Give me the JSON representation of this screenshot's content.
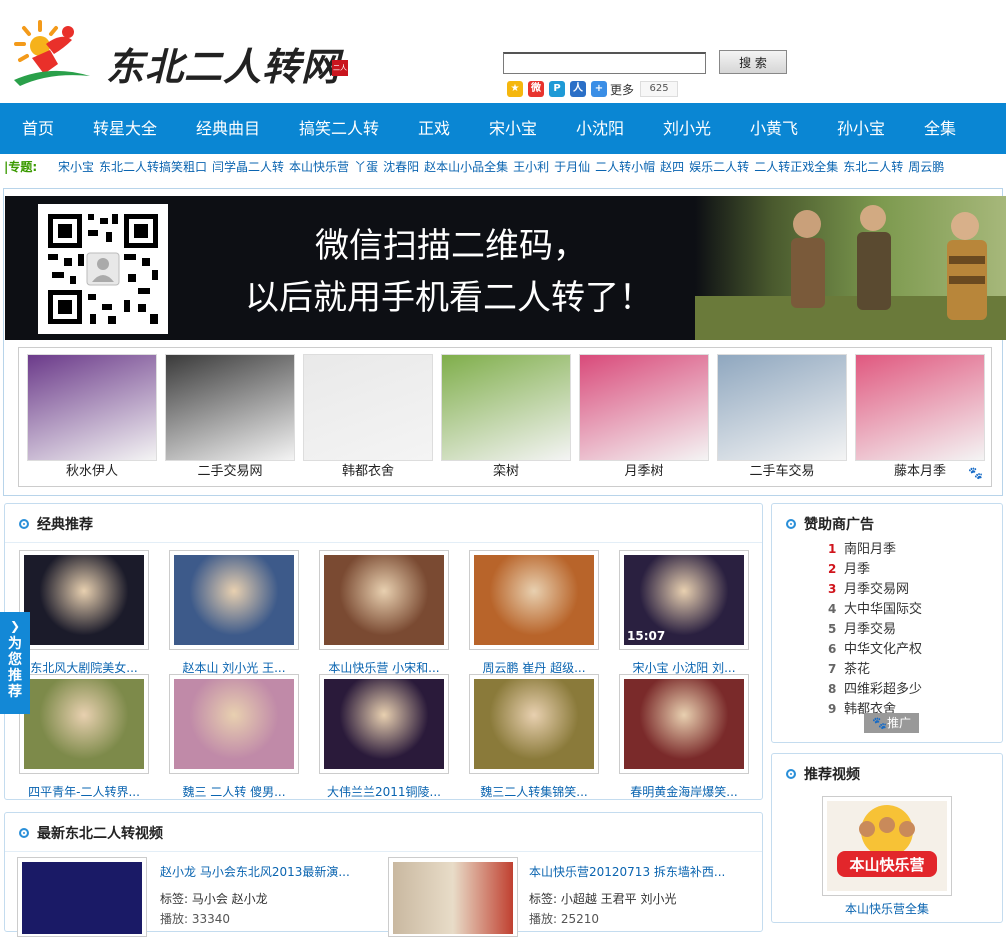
{
  "header": {
    "logo_text": "东北二人转网",
    "logo_stamp": "二人转",
    "search_button": "搜 索",
    "search_value": "",
    "share_more": "更多",
    "share_count": "625"
  },
  "nav": {
    "items": [
      {
        "label": "首页"
      },
      {
        "label": "转星大全"
      },
      {
        "label": "经典曲目"
      },
      {
        "label": "搞笑二人转"
      },
      {
        "label": "正戏"
      },
      {
        "label": "宋小宝"
      },
      {
        "label": "小沈阳"
      },
      {
        "label": "刘小光"
      },
      {
        "label": "小黄飞"
      },
      {
        "label": "孙小宝"
      },
      {
        "label": "全集"
      }
    ]
  },
  "topics": {
    "label": "|专题:",
    "links": [
      "宋小宝",
      "东北二人转搞笑粗口",
      "闫学晶二人转",
      "本山快乐营",
      "丫蛋",
      "沈春阳",
      "赵本山小品全集",
      "王小利",
      "于月仙",
      "二人转小帽",
      "赵四",
      "娱乐二人转",
      "二人转正戏全集",
      "东北二人转",
      "周云鹏"
    ]
  },
  "banner": {
    "line1": "微信扫描二维码，",
    "line2": "以后就用手机看二人转了！"
  },
  "ad_images": [
    {
      "caption": "秋水伊人",
      "color": "#6b3a8a"
    },
    {
      "caption": "二手交易网",
      "color": "#3a3a3a"
    },
    {
      "caption": "韩都衣舍",
      "color": "#e9e9e9"
    },
    {
      "caption": "栾树",
      "color": "#7fae4a"
    },
    {
      "caption": "月季树",
      "color": "#d94a7a"
    },
    {
      "caption": "二手车交易",
      "color": "#8fa7bf"
    },
    {
      "caption": "藤本月季",
      "color": "#e0587f"
    }
  ],
  "classic": {
    "title": "经典推荐",
    "videos": [
      {
        "caption": "东北风大剧院美女...",
        "color": "#1b1b2a"
      },
      {
        "caption": "赵本山 刘小光 王...",
        "color": "#3d5a8a"
      },
      {
        "caption": "本山快乐营 小宋和...",
        "color": "#7a4a32"
      },
      {
        "caption": "周云鹏 崔丹 超级...",
        "color": "#b8642a"
      },
      {
        "caption": "宋小宝 小沈阳 刘...",
        "color": "#2a2040"
      },
      {
        "caption": "四平青年-二人转界...",
        "color": "#7d8a4a"
      },
      {
        "caption": "魏三 二人转 傻男...",
        "color": "#c08aa8"
      },
      {
        "caption": "大伟兰兰2011铜陵...",
        "color": "#2a1a3a"
      },
      {
        "caption": "魏三二人转集锦笑...",
        "color": "#8a7a3a"
      },
      {
        "caption": "春明黄金海岸爆笑...",
        "color": "#7a2a2a"
      }
    ],
    "time_label": "15:07"
  },
  "sponsors": {
    "title": "赞助商广告",
    "items": [
      {
        "num": "1",
        "label": "南阳月季"
      },
      {
        "num": "2",
        "label": "月季"
      },
      {
        "num": "3",
        "label": "月季交易网"
      },
      {
        "num": "4",
        "label": "大中华国际交"
      },
      {
        "num": "5",
        "label": "月季交易"
      },
      {
        "num": "6",
        "label": "中华文化产权"
      },
      {
        "num": "7",
        "label": "茶花"
      },
      {
        "num": "8",
        "label": "四维彩超多少"
      },
      {
        "num": "9",
        "label": "韩都衣舍"
      }
    ],
    "promote": "推广"
  },
  "recommend": {
    "title": "推荐视频",
    "caption": "本山快乐营全集"
  },
  "side_float": {
    "label": "为您推荐"
  },
  "latest": {
    "title": "最新东北二人转视频",
    "items": [
      {
        "title": "赵小龙 马小会东北风2013最新演...",
        "tags": "标签:  马小会  赵小龙",
        "extra": "播放: 33340"
      },
      {
        "title": "本山快乐营20120713 拆东墙补西...",
        "tags": "标签:  小超越  王君平  刘小光",
        "extra": "播放: 25210"
      }
    ]
  }
}
